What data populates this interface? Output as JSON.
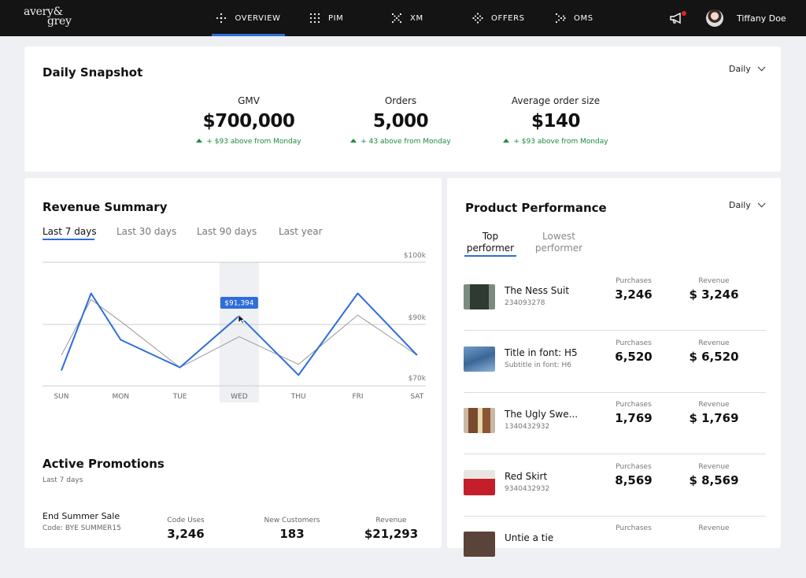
{
  "brand": {
    "logo_line1": "avery&",
    "logo_line2": "grey"
  },
  "nav": {
    "items": [
      {
        "label": "OVERVIEW",
        "icon": "sparkle-icon",
        "active": true
      },
      {
        "label": "PIM",
        "icon": "grid-dots-icon",
        "active": false
      },
      {
        "label": "XM",
        "icon": "x-dots-icon",
        "active": false
      },
      {
        "label": "OFFERS",
        "icon": "diamond-dots-icon",
        "active": false
      },
      {
        "label": "OMS",
        "icon": "arrow-dots-icon",
        "active": false
      }
    ],
    "user_name": "Tiffany Doe",
    "accent": "#2f6ed8"
  },
  "snapshot": {
    "title": "Daily Snapshot",
    "period": "Daily",
    "metrics": [
      {
        "label": "GMV",
        "value": "$700,000",
        "delta": "+ $93 above from Monday"
      },
      {
        "label": "Orders",
        "value": "5,000",
        "delta": "+ 43 above from Monday"
      },
      {
        "label": "Average order size",
        "value": "$140",
        "delta": "+ $93 above from Monday"
      }
    ]
  },
  "revenue": {
    "title": "Revenue Summary",
    "tabs": [
      "Last 7 days",
      "Last 30 days",
      "Last 90 days",
      "Last year"
    ],
    "active_tab": 0,
    "tooltip": "$91,394"
  },
  "chart_data": {
    "type": "line",
    "categories": [
      "SUN",
      "MON",
      "TUE",
      "WED",
      "THU",
      "FRI",
      "SAT"
    ],
    "y_ticks": [
      "$100k",
      "$90k",
      "$70k"
    ],
    "highlight_category": "WED",
    "series": [
      {
        "color": "#2f6ed8",
        "points": [
          [
            0,
            75
          ],
          [
            0.5,
            95
          ],
          [
            1,
            85
          ],
          [
            2,
            76
          ],
          [
            3,
            91.4
          ],
          [
            4,
            73.5
          ],
          [
            5,
            95
          ],
          [
            6,
            80
          ]
        ]
      },
      {
        "color": "#999999",
        "points": [
          [
            0,
            80
          ],
          [
            0.5,
            94
          ],
          [
            1,
            90.5
          ],
          [
            2,
            76
          ],
          [
            3,
            86
          ],
          [
            4,
            77
          ],
          [
            5,
            91.5
          ],
          [
            6,
            80
          ]
        ]
      }
    ]
  },
  "promotions": {
    "title": "Active Promotions",
    "subtitle": "Last 7 days",
    "item": {
      "name": "End Summer Sale",
      "code": "Code: BYE SUMMER15",
      "columns": [
        {
          "header": "Code Uses",
          "value": "3,246"
        },
        {
          "header": "New Customers",
          "value": "183"
        },
        {
          "header": "Revenue",
          "value": "$21,293"
        }
      ]
    }
  },
  "product": {
    "title": "Product Performance",
    "period": "Daily",
    "tab_top_l1": "Top",
    "tab_top_l2": "performer",
    "tab_low_l1": "Lowest",
    "tab_low_l2": "performer",
    "purchases_header": "Purchases",
    "revenue_header": "Revenue",
    "rows": [
      {
        "name": "The Ness Suit",
        "sub": "234093278",
        "purchases": "3,246",
        "revenue": "$ 3,246"
      },
      {
        "name": "Title in font: H5",
        "sub": "Subtitle in font: H6",
        "purchases": "6,520",
        "revenue": "$ 6,520"
      },
      {
        "name": "The Ugly Swe...",
        "sub": "1340432932",
        "purchases": "1,769",
        "revenue": "$ 1,769"
      },
      {
        "name": "Red Skirt",
        "sub": "9340432932",
        "purchases": "8,569",
        "revenue": "$ 8,569"
      },
      {
        "name": "Untie a tie",
        "sub": "",
        "purchases": "",
        "revenue": ""
      }
    ]
  }
}
